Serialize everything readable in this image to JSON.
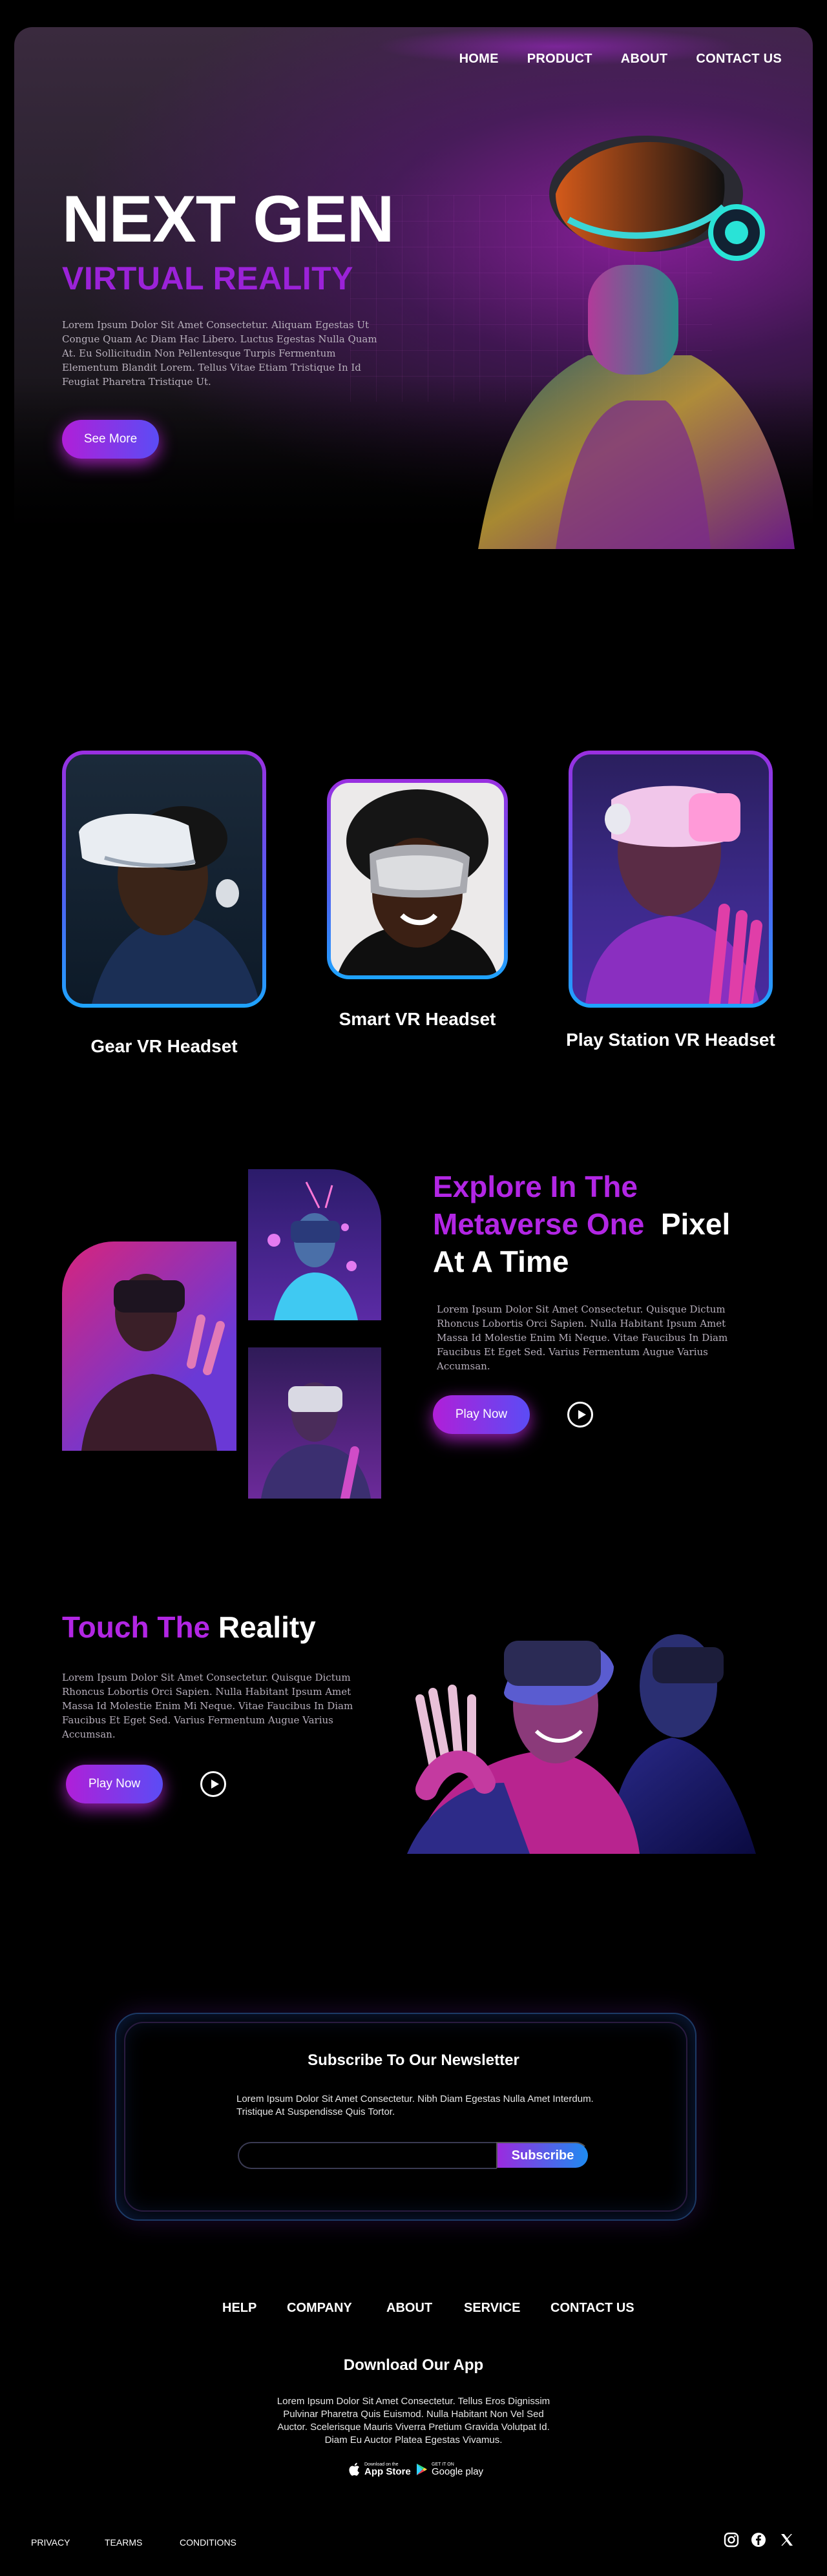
{
  "nav": {
    "items": [
      "HOME",
      "PRODUCT",
      "ABOUT",
      "CONTACT US"
    ]
  },
  "hero": {
    "title": "NEXT GEN",
    "subtitle": "VIRTUAL REALITY",
    "text": "Lorem Ipsum Dolor Sit Amet Consectetur. Aliquam Egestas Ut Congue Quam Ac Diam Hac Libero. Luctus Egestas Nulla Quam At. Eu Sollicitudin Non Pellentesque Turpis Fermentum Elementum Blandit Lorem. Tellus Vitae Etiam Tristique In Id Feugiat Pharetra Tristique Ut.",
    "button": "See More"
  },
  "products": [
    {
      "label": "Gear VR Headset"
    },
    {
      "label": "Smart VR Headset"
    },
    {
      "label": "Play Station VR Headset"
    }
  ],
  "metaverse": {
    "title_accent_1": "Explore In The",
    "title_accent_2": "Metaverse One",
    "title_plain_1": "Pixel",
    "title_plain_2": "At A Time",
    "text": "Lorem Ipsum Dolor Sit Amet Consectetur. Quisque Dictum Rhoncus Lobortis Orci Sapien. Nulla Habitant Ipsum Amet Massa Id Molestie Enim Mi Neque. Vitae Faucibus In Diam Faucibus Et Eget Sed. Varius Fermentum Augue Varius Accumsan.",
    "button": "Play Now"
  },
  "reality": {
    "title_accent": "Touch The",
    "title_plain": "Reality",
    "text": "Lorem Ipsum Dolor Sit Amet Consectetur. Quisque Dictum Rhoncus Lobortis Orci Sapien. Nulla Habitant Ipsum Amet Massa Id Molestie Enim Mi Neque. Vitae Faucibus In Diam Faucibus Et Eget Sed. Varius Fermentum Augue Varius Accumsan.",
    "button": "Play Now"
  },
  "newsletter": {
    "title": "Subscribe To Our Newsletter",
    "text": "Lorem Ipsum Dolor Sit Amet Consectetur. Nibh Diam Egestas Nulla Amet Interdum. Tristique At Suspendisse Quis Tortor.",
    "input_placeholder": "",
    "button": "Subscribe"
  },
  "footer": {
    "nav": [
      "HELP",
      "COMPANY",
      "ABOUT",
      "SERVICE",
      "CONTACT US"
    ],
    "app_title": "Download Our App",
    "app_text": "Lorem Ipsum Dolor Sit Amet Consectetur. Tellus Eros Dignissim Pulvinar Pharetra Quis Euismod. Nulla Habitant Non Vel Sed Auctor. Scelerisque Mauris Viverra Pretium Gravida Volutpat Id. Diam Eu Auctor Platea Egestas Vivamus.",
    "appstore_small": "Download on the",
    "appstore_big": "App Store",
    "gplay_small": "GET IT ON",
    "gplay_big": "Google play",
    "bottom_links": [
      "PRIVACY",
      "TEARMS",
      "CONDITIONS"
    ],
    "social_icons": [
      "instagram-icon",
      "facebook-icon",
      "x-icon"
    ]
  },
  "colors": {
    "accent_purple": "#b226e4",
    "accent_blue": "#1ea4ff",
    "background": "#000000"
  }
}
